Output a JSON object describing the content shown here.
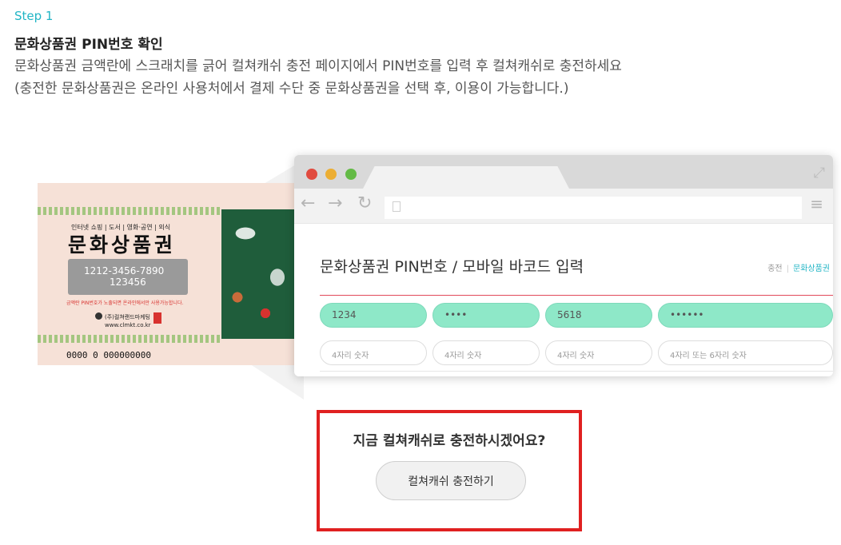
{
  "step": {
    "label": "Step 1",
    "title": "문화상품권 PIN번호 확인",
    "desc_line1": "문화상품권 금액란에 스크래치를 긁어 컬쳐캐쉬 충전 페이지에서 PIN번호를 입력 후 컬쳐캐쉬로 충전하세요",
    "desc_line2": "(충전한 문화상품권은 온라인 사용처에서 결제 수단 중 문화상품권을 선택 후, 이용이 가능합니다.)"
  },
  "gift_card": {
    "categories": "인터넷 쇼핑 | 도서 | 영화·공연 | 외식",
    "title": "문화상품권",
    "pin_line1": "1212-3456-7890",
    "pin_line2": "123456",
    "warning": "금액란 PIN번호가 노출되면 온라인에서만 사용가능합니다.",
    "company": "(주)컬쳐랜드마케팅",
    "url": "www.clmkt.co.kr",
    "serial": "0000 0 000000000"
  },
  "browser": {
    "icons": {
      "back": "arrow-left-icon",
      "forward": "arrow-right-icon",
      "reload": "reload-icon",
      "menu": "hamburger-menu-icon",
      "expand": "expand-icon",
      "page": "page-icon"
    },
    "colors": {
      "close": "#e14b3f",
      "minimize": "#ecae33",
      "maximize": "#63ba45"
    },
    "page": {
      "title": "문화상품권 PIN번호 / 모바일 바코드 입력",
      "breadcrumb": {
        "parent": "충전",
        "current": "문화상품권"
      },
      "fields_row1": [
        "1234",
        "••••",
        "5618",
        "••••••"
      ],
      "fields_row2": [
        "4자리 숫자",
        "4자리 숫자",
        "4자리 숫자",
        "4자리 또는 6자리 숫자"
      ]
    }
  },
  "callout": {
    "question": "지금 컬쳐캐쉬로 충전하시겠어요?",
    "button_label": "컬쳐캐쉬 충전하기",
    "border_color": "#e02020"
  },
  "accent_color": "#21b5c5"
}
